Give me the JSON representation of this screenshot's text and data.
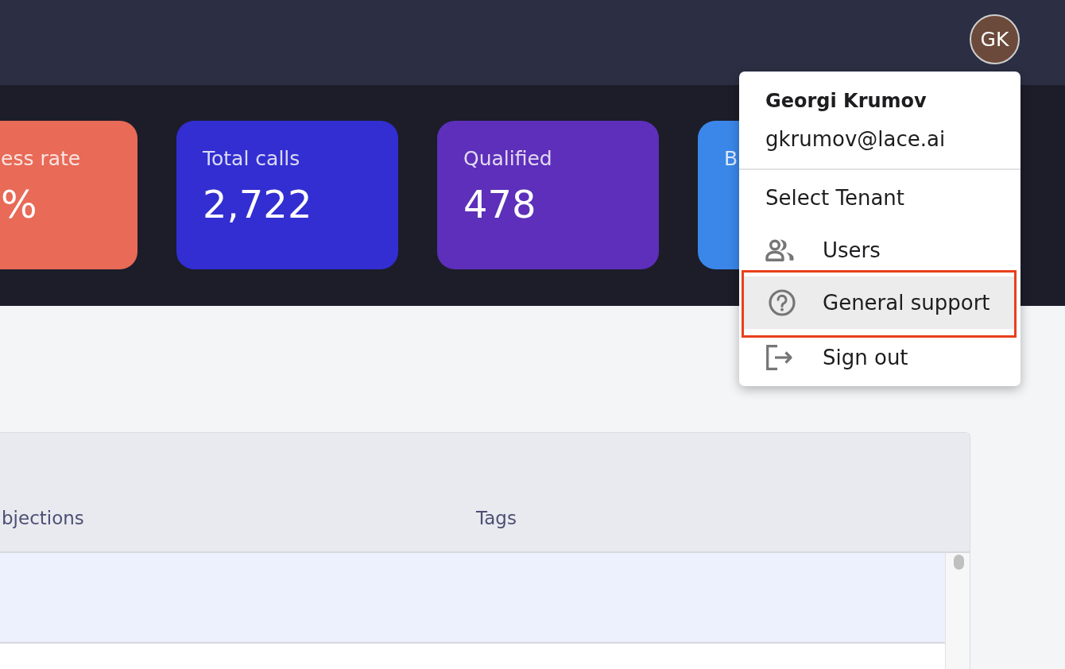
{
  "header": {
    "avatar": {
      "initials": "GK"
    }
  },
  "stat_cards": [
    {
      "label": "ess rate",
      "value": "%",
      "color": "#e86a57"
    },
    {
      "label": "Total calls",
      "value": "2,722",
      "color": "#322ed1"
    },
    {
      "label": "Qualified",
      "value": "478",
      "color": "#5d2fba"
    },
    {
      "label": "B",
      "color": "#3a87e9"
    }
  ],
  "user_menu": {
    "name": "Georgi Krumov",
    "email": "gkrumov@lace.ai",
    "items": [
      {
        "kind": "plain",
        "label": "Select Tenant",
        "selected": false,
        "outlined": false
      },
      {
        "kind": "users",
        "label": "Users",
        "selected": false,
        "outlined": false
      },
      {
        "kind": "help",
        "label": "General support",
        "selected": true,
        "outlined": true
      },
      {
        "kind": "sign-out",
        "label": "Sign out",
        "selected": false,
        "outlined": false
      }
    ]
  },
  "table": {
    "columns": [
      "bjections",
      "Tags"
    ],
    "rows": [
      {
        "selected": true
      },
      {
        "selected": false
      }
    ]
  }
}
